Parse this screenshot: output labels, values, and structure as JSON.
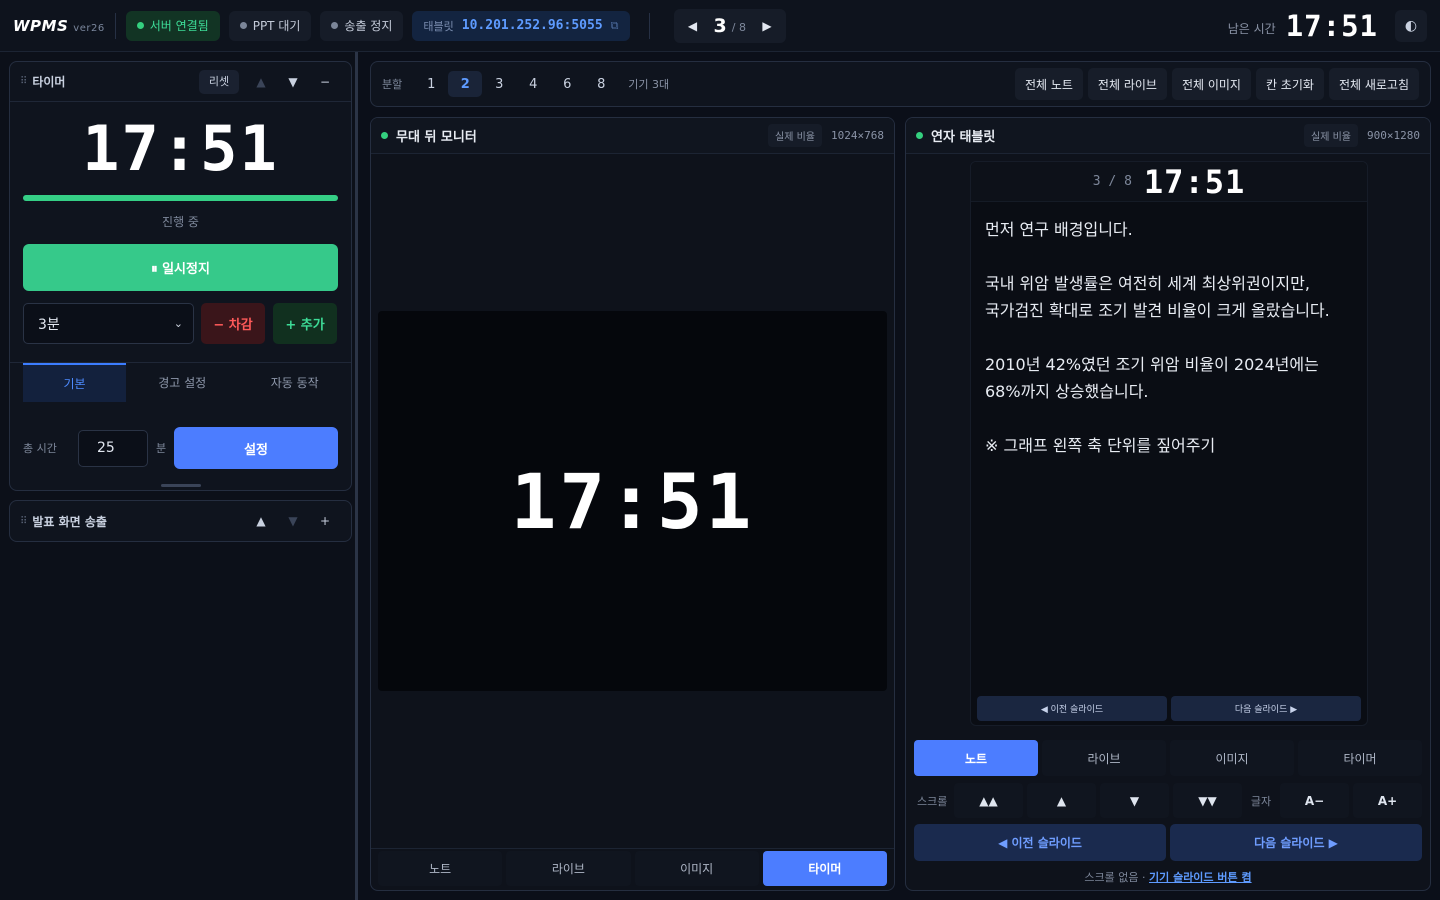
{
  "topbar": {
    "brand": "WPMS",
    "version": "ver26",
    "server_status": "서버 연결됨",
    "ppt_status": "PPT 대기",
    "broadcast_status": "송출 정지",
    "tablet_label": "태블릿",
    "tablet_ip": "10.201.252.96:5055",
    "copy_icon": "⧉",
    "prev_icon": "◀",
    "next_icon": "▶",
    "page_current": "3",
    "page_total": "/ 8",
    "remaining_label": "남은 시간",
    "remaining_time": "17:51",
    "theme_icon": "◐"
  },
  "timer_card": {
    "grip": "⠿",
    "title": "타이머",
    "reset": "리셋",
    "up": "▲",
    "down": "▼",
    "collapse": "−",
    "time": "17:51",
    "progress": 1.0,
    "state": "진행 중",
    "pause_label": "⏸ 일시정지",
    "duration_select": "3분",
    "minus_label": "− 차감",
    "plus_label": "+ 추가",
    "tabs": [
      "기본",
      "경고 설정",
      "자동 동작"
    ],
    "total_label": "총 시간",
    "total_value": "25",
    "unit": "분",
    "set_label": "설정"
  },
  "broadcast_card": {
    "grip": "⠿",
    "title": "발표 화면 송출",
    "up": "▲",
    "down": "▼",
    "expand": "+"
  },
  "toolbar": {
    "split_label": "분할",
    "splits": [
      "1",
      "2",
      "3",
      "4",
      "6",
      "8"
    ],
    "active_split": "2",
    "device_count": "기기 3대",
    "actions": [
      "전체 노트",
      "전체 라이브",
      "전체 이미지",
      "칸 초기화",
      "전체 새로고침"
    ]
  },
  "stage_pane": {
    "title": "무대 뒤 모니터",
    "ratio_label": "실제 비율",
    "ratio": "1024×768",
    "time": "17:51",
    "tabs": [
      "노트",
      "라이브",
      "이미지",
      "타이머"
    ],
    "active_tab": "타이머"
  },
  "tablet_pane": {
    "title": "연자 태블릿",
    "ratio_label": "실제 비율",
    "ratio": "900×1280",
    "page": "3 / 8",
    "time": "17:51",
    "notes": [
      "먼저 연구 배경입니다.",
      "국내 위암 발생률은 여전히 세계 최상위권이지만,\n국가검진 확대로 조기 발견 비율이 크게 올랐습니다.",
      "2010년 42%였던 조기 위암 비율이 2024년에는 68%까지 상승했습니다.",
      "※ 그래프 왼쪽 축 단위를 짚어주기"
    ],
    "tablet_prev": "◀ 이전 슬라이드",
    "tablet_next": "다음 슬라이드 ▶",
    "modes": [
      "노트",
      "라이브",
      "이미지",
      "타이머"
    ],
    "active_mode": "노트",
    "scroll_label": "스크롤",
    "scroll_buttons": [
      "▲▲",
      "▲",
      "▼",
      "▼▼"
    ],
    "font_label": "글자",
    "font_minus": "A−",
    "font_plus": "A+",
    "prev_slide": "◀ 이전 슬라이드",
    "next_slide": "다음 슬라이드 ▶",
    "footer_text": "스크롤 없음 · ",
    "footer_link": "기기 슬라이드 버튼 켬"
  },
  "colors": {
    "accent": "#4c7dff",
    "success": "#36c98a",
    "danger": "#ff5a5a",
    "background": "#0b0f19"
  }
}
